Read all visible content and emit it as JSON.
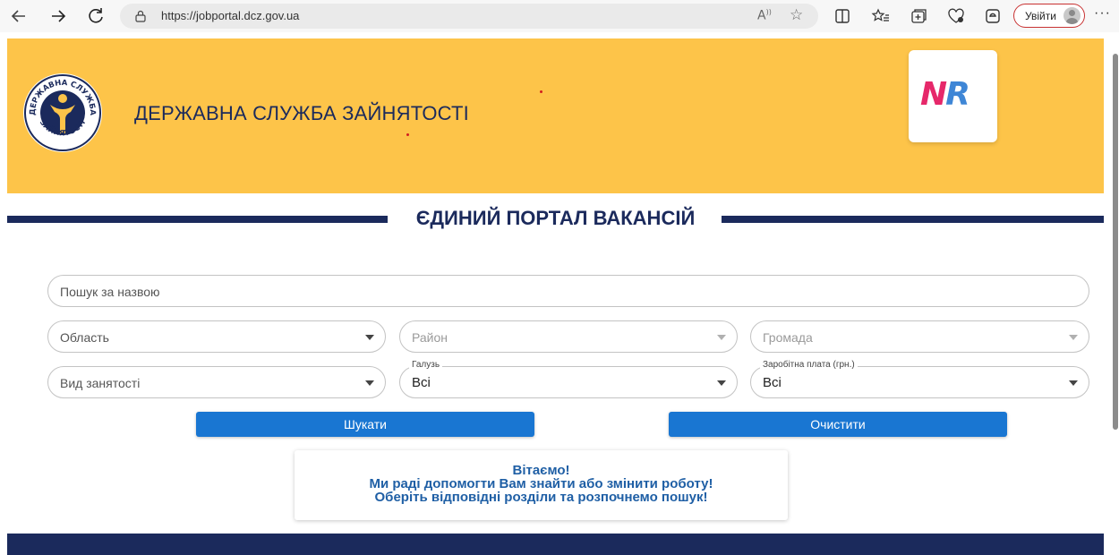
{
  "browser": {
    "url": "https://jobportal.dcz.gov.ua",
    "signin_label": "Увійти",
    "more_label": "···",
    "icons": [
      "back-arrow-icon",
      "forward-arrow-icon",
      "refresh-icon",
      "lock-icon",
      "read-aloud-icon",
      "favorite-star-icon",
      "split-screen-icon",
      "favorites-icon",
      "collections-icon",
      "browser-essentials-icon",
      "copilot-icon",
      "more-icon"
    ]
  },
  "header": {
    "org_title": "ДЕРЖАВНА СЛУЖБА ЗАЙНЯТОСТІ",
    "emblem_text_top": "ДЕРЖАВНА СЛУЖБА",
    "emblem_text_bottom": "ЗАЙНЯТОСТІ",
    "partner_logo": {
      "n": "N",
      "r": "R"
    },
    "colors": {
      "banner": "#fdc449",
      "navy": "#1b2a5c",
      "logo_pink": "#e6286a",
      "logo_blue": "#3e86d6"
    }
  },
  "portal": {
    "title": "ЄДИНИЙ ПОРТАЛ ВАКАНСІЙ"
  },
  "search": {
    "name_placeholder": "Пошук за назвою",
    "region_placeholder": "Область",
    "district_placeholder": "Район",
    "community_placeholder": "Громада",
    "employment_placeholder": "Вид занятості",
    "industry_label": "Галузь",
    "industry_value": "Всі",
    "salary_label": "Заробітна плата (грн.)",
    "salary_value": "Всі",
    "search_button": "Шукати",
    "clear_button": "Очистити",
    "accent_color": "#1976d2"
  },
  "welcome": {
    "line1": "Вітаємо!",
    "line2": "Ми раді допомогти Вам знайти або змінити роботу!",
    "line3": "Оберіть відповідні розділи та розпочнемо пошук!",
    "text_color": "#1f5fa5"
  }
}
